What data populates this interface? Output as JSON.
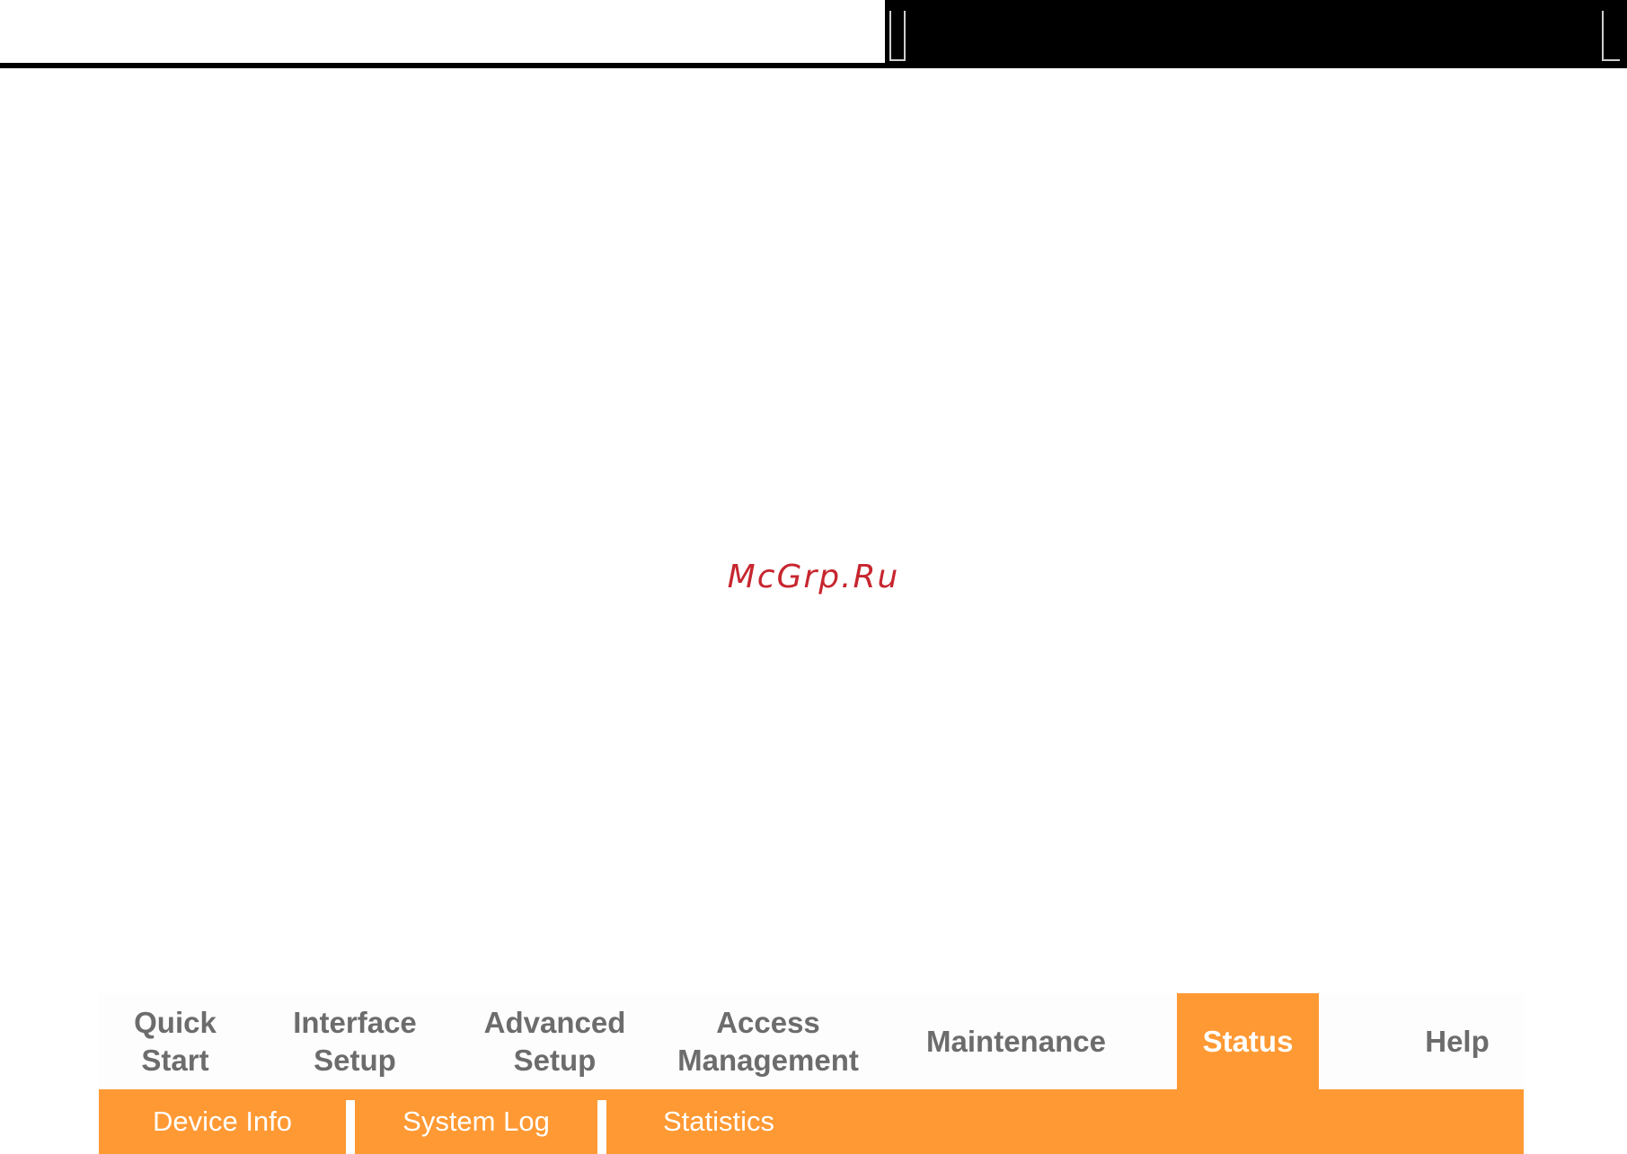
{
  "watermark": "McGrp.Ru",
  "colors": {
    "accent": "#ff9933",
    "inactive_tab_text": "#6c6c6c",
    "watermark": "#c7262f"
  },
  "menu": {
    "main_tabs": [
      {
        "label": "Quick\nStart",
        "active": false
      },
      {
        "label": "Interface\nSetup",
        "active": false
      },
      {
        "label": "Advanced\nSetup",
        "active": false
      },
      {
        "label": "Access\nManagement",
        "active": false
      },
      {
        "label": "Maintenance",
        "active": false
      },
      {
        "label": "Status",
        "active": true
      },
      {
        "label": "Help",
        "active": false
      }
    ],
    "sub_tabs": [
      {
        "label": "Device Info"
      },
      {
        "label": "System Log"
      },
      {
        "label": "Statistics"
      }
    ]
  }
}
